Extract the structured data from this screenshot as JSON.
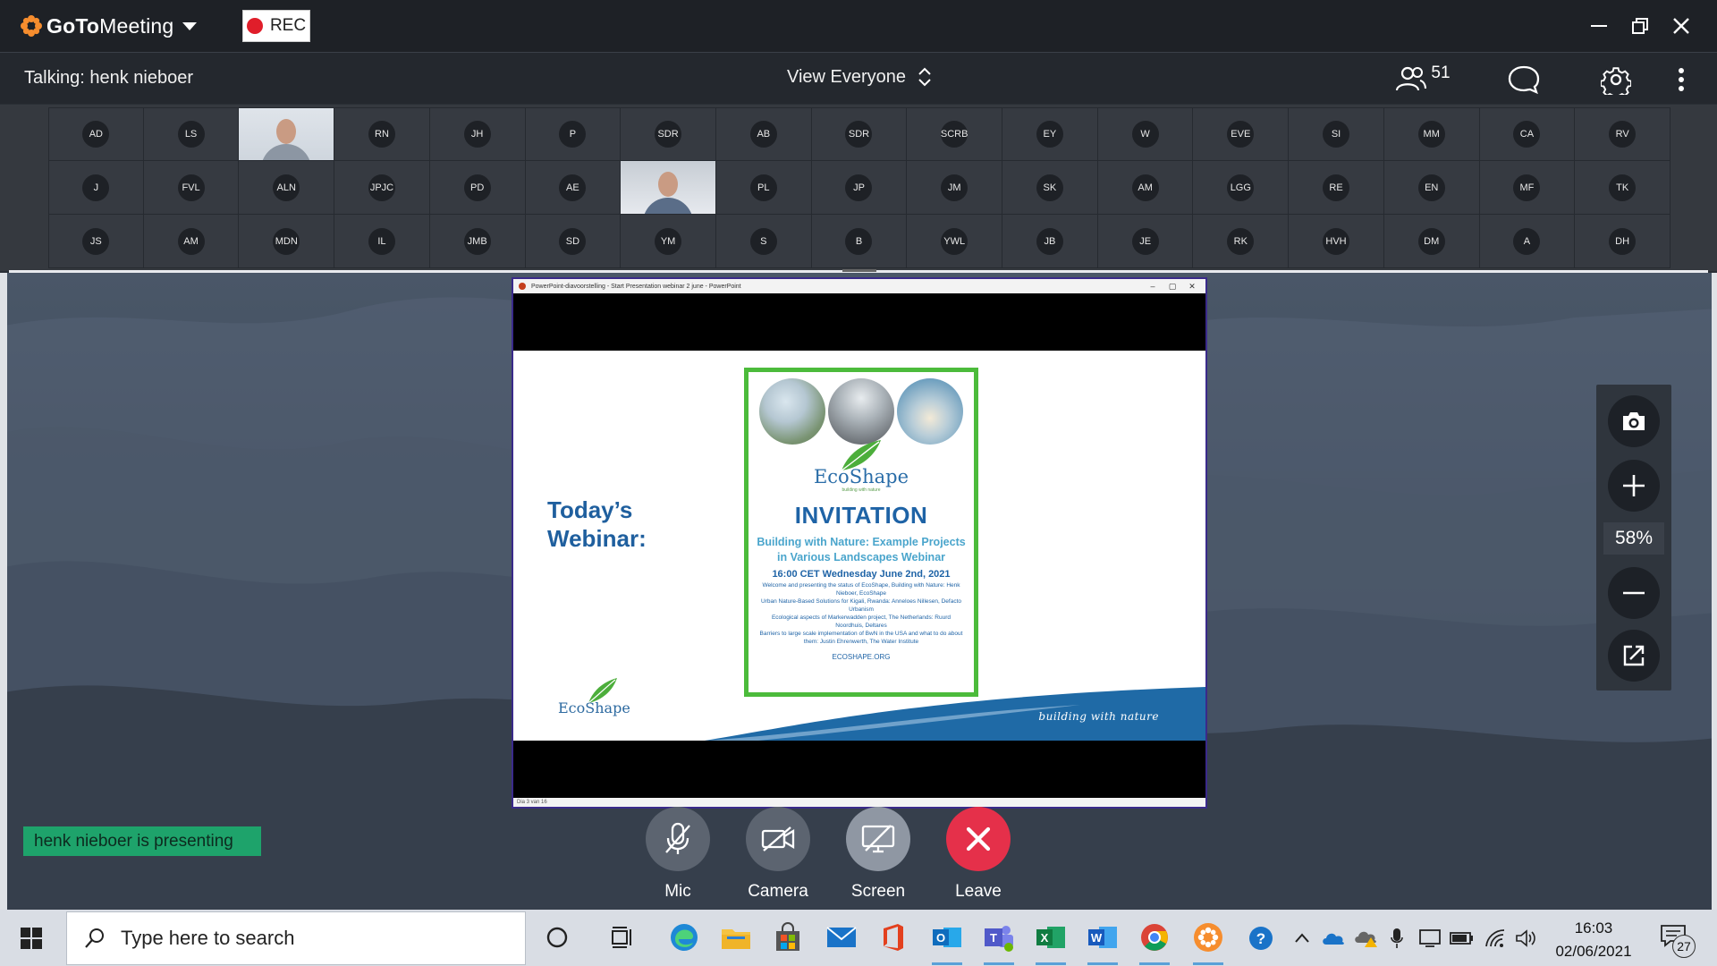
{
  "app": {
    "brand_prefix": "GoTo",
    "brand_suffix": "Meeting",
    "rec_label": "REC"
  },
  "infobar": {
    "talking": "Talking: henk nieboer",
    "view_label": "View Everyone",
    "attendee_count": "51"
  },
  "attendees": [
    "AD",
    "LS",
    "",
    "RN",
    "JH",
    "P",
    "SDR",
    "AB",
    "SDR",
    "SCRB",
    "EY",
    "W",
    "EVE",
    "SI",
    "MM",
    "CA",
    "RV",
    "J",
    "FVL",
    "ALN",
    "JPJC",
    "PD",
    "AE",
    "",
    "PL",
    "JP",
    "JM",
    "SK",
    "AM",
    "LGG",
    "RE",
    "EN",
    "MF",
    "TK",
    "JS",
    "AM",
    "MDN",
    "IL",
    "JMB",
    "SD",
    "YM",
    "S",
    "B",
    "YWL",
    "JB",
    "JE",
    "RK",
    "HVH",
    "DM",
    "A",
    "DH"
  ],
  "shared_screen": {
    "window_title": "PowerPoint-diavoorstelling  -  Start Presentation webinar 2 june  -  PowerPoint",
    "status_text": "Dia 3 van 16",
    "today_line1": "Today’s",
    "today_line2": "Webinar:",
    "eco_small": "EcoShape",
    "building_with_nature": "building with nature",
    "poster": {
      "brand": "EcoShape",
      "brand_tagline": "building with nature",
      "heading": "INVITATION",
      "title_line1": "Building with Nature: Example Projects",
      "title_line2": "in Various Landscapes Webinar",
      "date": "16:00 CET Wednesday June 2nd, 2021",
      "bullets": [
        "Welcome and presenting the status of EcoShape, Building with Nature: Henk Nieboer, EcoShape",
        "Urban Nature-Based Solutions for Kigali, Rwanda: Anneloes Nillesen, Defacto Urbanism",
        "Ecological aspects of Markerwadden project, The Netherlands: Ruurd Noordhuis, Deltares",
        "Barriers to large scale implementation of BwN in the USA and what to do about them: Justin Ehrenwerth, The Water Institute"
      ],
      "url": "ECOSHAPE.ORG"
    }
  },
  "zoom": {
    "level": "58%"
  },
  "presenting_badge": "henk nieboer is presenting",
  "controls": {
    "mic": "Mic",
    "camera": "Camera",
    "screen": "Screen",
    "leave": "Leave"
  },
  "taskbar": {
    "search_placeholder": "Type here to search",
    "time": "16:03",
    "date": "02/06/2021",
    "notification_count": "27"
  },
  "colors": {
    "titlebar": "#1e2126",
    "brand_orange": "#f68d2e",
    "leave_red": "#e5304a",
    "presenting_green": "#1ea36b",
    "slide_blue": "#1f5f9e",
    "poster_green": "#4cbb3b"
  }
}
